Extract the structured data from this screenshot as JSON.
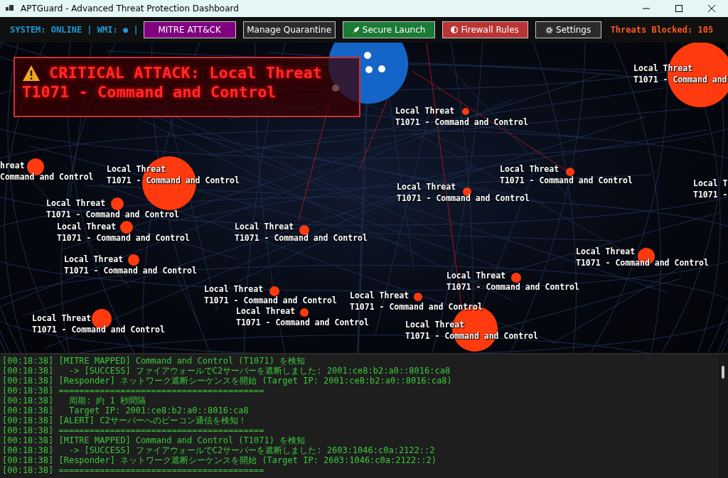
{
  "window": {
    "title": "APTGuard - Advanced Threat Protection Dashboard"
  },
  "toolbar": {
    "status": "SYSTEM: ONLINE | WMI: ● |",
    "buttons": [
      {
        "label": "MITRE ATT&CK",
        "kind": "mitre"
      },
      {
        "label": "Manage Quarantine",
        "kind": "plain"
      },
      {
        "label": "Secure Launch",
        "kind": "launch"
      },
      {
        "label": "Firewall Rules",
        "kind": "firewall"
      },
      {
        "label": "Settings",
        "kind": "settings"
      }
    ],
    "counter": "Threats Blocked: 105"
  },
  "alert": {
    "title": "CRITICAL ATTACK: Local Threat",
    "technique": "T1071 - Command and Control"
  },
  "threats": [
    {
      "name": "Local Threat",
      "technique": "T1071 - Command and Control"
    },
    {
      "name": "Local Threat",
      "technique": "T1071 - Command and"
    },
    {
      "name": "Local Threat",
      "technique": "T1071 - Command and Control"
    },
    {
      "name": "Local Threat",
      "technique": "T1071 - Command and Control"
    },
    {
      "name": "Local Threat",
      "technique": "T1071 - Command and Control"
    },
    {
      "name": "Local Threat",
      "technique": "T1071 - Command and Control"
    },
    {
      "name": "Local Threat",
      "technique": "T1071 - Command and Control"
    },
    {
      "name": "Local Threat",
      "technique": "T1071 - Command and Control"
    },
    {
      "name": "Local Threat",
      "technique": "T1071 - Command and Control"
    },
    {
      "name": "Local Threat",
      "technique": "T1071 - Command and Control"
    },
    {
      "name": "Local Threat",
      "technique": "T1071 - Command and Control"
    },
    {
      "name": "Local Threat",
      "technique": "T1071 - Command and Control"
    },
    {
      "name": "Local Threat",
      "technique": "T1071 - Command and Control"
    },
    {
      "name": "Local Threat",
      "technique": "T1071 - Command and Control"
    },
    {
      "name": "Local Threat",
      "technique": "T1071 - Command and Control"
    },
    {
      "name": "Local T",
      "technique": "T1071 -"
    },
    {
      "name": "hreat",
      "technique": "Command and Control"
    },
    {
      "name": "Local Threat",
      "technique": "T1071 - Command and Control"
    }
  ],
  "log": [
    "[00:18:38] [MITRE MAPPED] Command and Control (T1071) を検知",
    "[00:18:38]   -> [SUCCESS] ファイアウォールでC2サーバーを遮断しました: 2001:ce8:b2:a0::8016:ca8",
    "[00:18:38] [Responder] ネットワーク遮断シーケンスを開始 (Target IP: 2001:ce8:b2:a0::8016:ca8)",
    "[00:18:38] ========================================",
    "[00:18:38]   周期: 約 1 秒間隔",
    "[00:18:38]   Target IP: 2001:ce8:b2:a0::8016:ca8",
    "[00:18:38] [ALERT] C2サーバーへのビーコン通信を検知！",
    "[00:18:38] ========================================",
    "[00:18:38] [MITRE MAPPED] Command and Control (T1071) を検知",
    "[00:18:38]   -> [SUCCESS] ファイアウォールでC2サーバーを遮断しました: 2603:1046:c0a:2122::2",
    "[00:18:38] [Responder] ネットワーク遮断シーケンスを開始 (Target IP: 2603:1046:c0a:2122::2)",
    "[00:18:38] ========================================"
  ]
}
